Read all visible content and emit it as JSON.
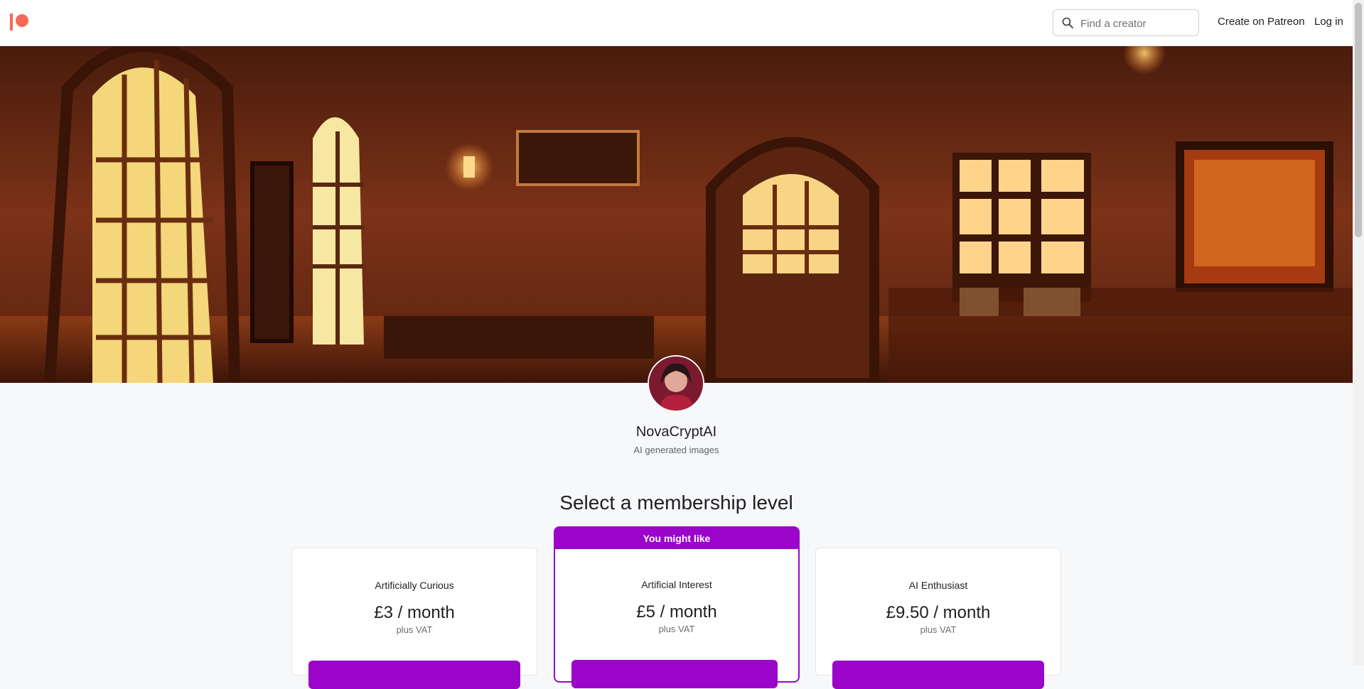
{
  "header": {
    "logo_label": "Patreon",
    "search": {
      "placeholder": "Find a creator",
      "value": ""
    },
    "nav": [
      {
        "label": "Create on Patreon"
      },
      {
        "label": "Log in"
      }
    ]
  },
  "creator": {
    "name": "NovaCryptAI",
    "tagline": "AI generated images"
  },
  "membership": {
    "title": "Select a membership level",
    "tiers": [
      {
        "name": "Artificially Curious",
        "price": "£3 / month",
        "vat": "plus VAT",
        "featured": false,
        "button_label": ""
      },
      {
        "name": "Artificial Interest",
        "price": "£5 / month",
        "vat": "plus VAT",
        "featured": true,
        "featured_label": "You might like",
        "button_label": ""
      },
      {
        "name": "AI Enthusiast",
        "price": "£9.50 / month",
        "vat": "plus VAT",
        "featured": false,
        "button_label": ""
      }
    ]
  },
  "colors": {
    "brand": "#f96854",
    "accent": "#9b04c9",
    "page_bg": "#f7f8fa"
  },
  "icons": {
    "logo": "patreon-logo",
    "search": "search-icon"
  }
}
